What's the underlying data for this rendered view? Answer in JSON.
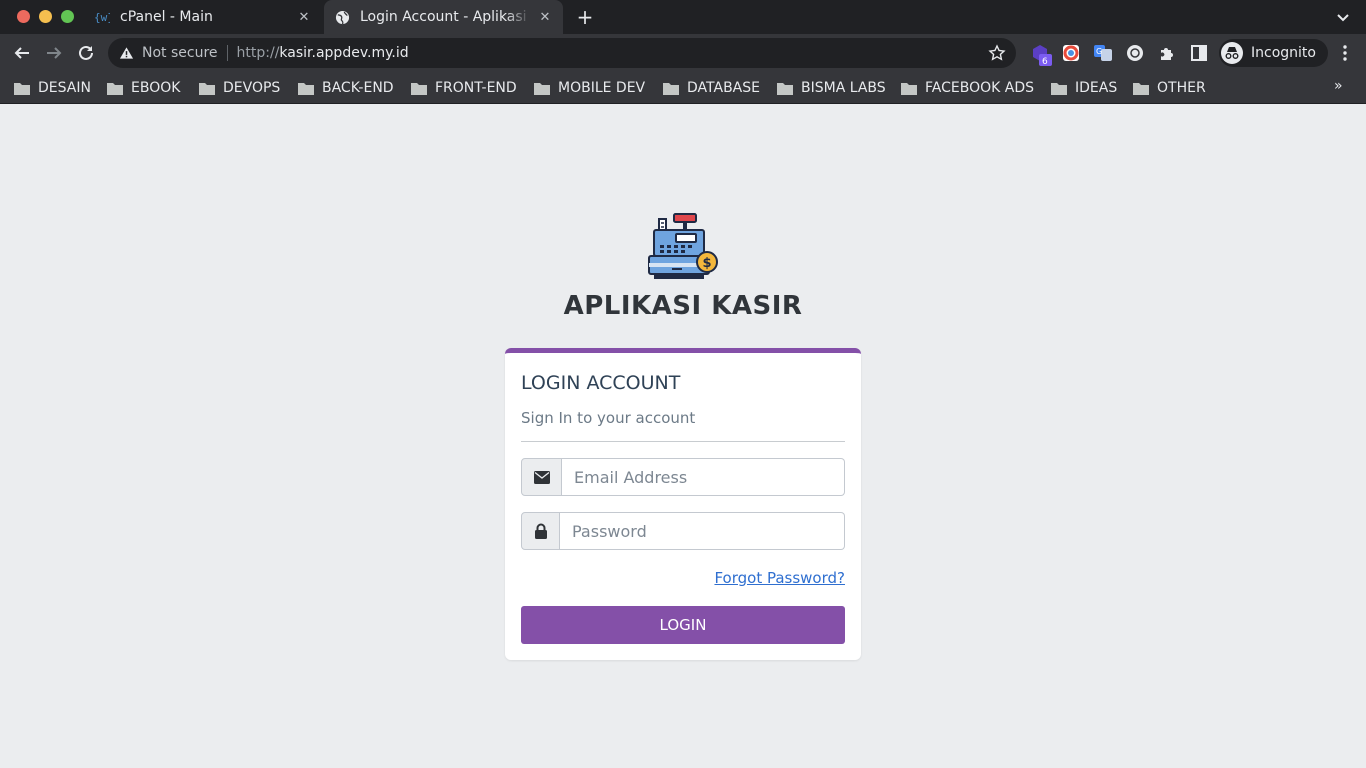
{
  "browser": {
    "tabs": [
      {
        "title": "cPanel - Main",
        "favicon": "wordpress-bracket-icon",
        "active": false
      },
      {
        "title": "Login Account - Aplikasi K",
        "favicon": "globe-icon",
        "active": true
      }
    ],
    "address": {
      "security_label": "Not secure",
      "url_scheme": "http://",
      "url_host": "kasir.appdev.my.id"
    },
    "extensions": [
      {
        "name": "notification-extension-icon",
        "badge": "6"
      },
      {
        "name": "colorzilla-extension-icon"
      },
      {
        "name": "translate-extension-icon"
      },
      {
        "name": "privacy-extension-icon"
      },
      {
        "name": "puzzle-extensions-icon"
      },
      {
        "name": "side-panel-icon"
      }
    ],
    "profile_label": "Incognito",
    "bookmarks": [
      "DESAIN",
      "EBOOK",
      "DEVOPS",
      "BACK-END",
      "FRONT-END",
      "MOBILE DEV",
      "DATABASE",
      "BISMA LABS",
      "FACEBOOK ADS",
      "IDEAS",
      "OTHER"
    ],
    "bookmarks_overflow": "»"
  },
  "page": {
    "app_title": "APLIKASI KASIR",
    "logo_icon": "cash-register-icon",
    "card": {
      "title": "LOGIN ACCOUNT",
      "subtitle": "Sign In to your account",
      "email_placeholder": "Email Address",
      "password_placeholder": "Password",
      "forgot_link": "Forgot Password?",
      "login_button": "LOGIN"
    },
    "colors": {
      "accent": "#8450a8",
      "link": "#2f6fd0",
      "background": "#ebedef"
    }
  }
}
